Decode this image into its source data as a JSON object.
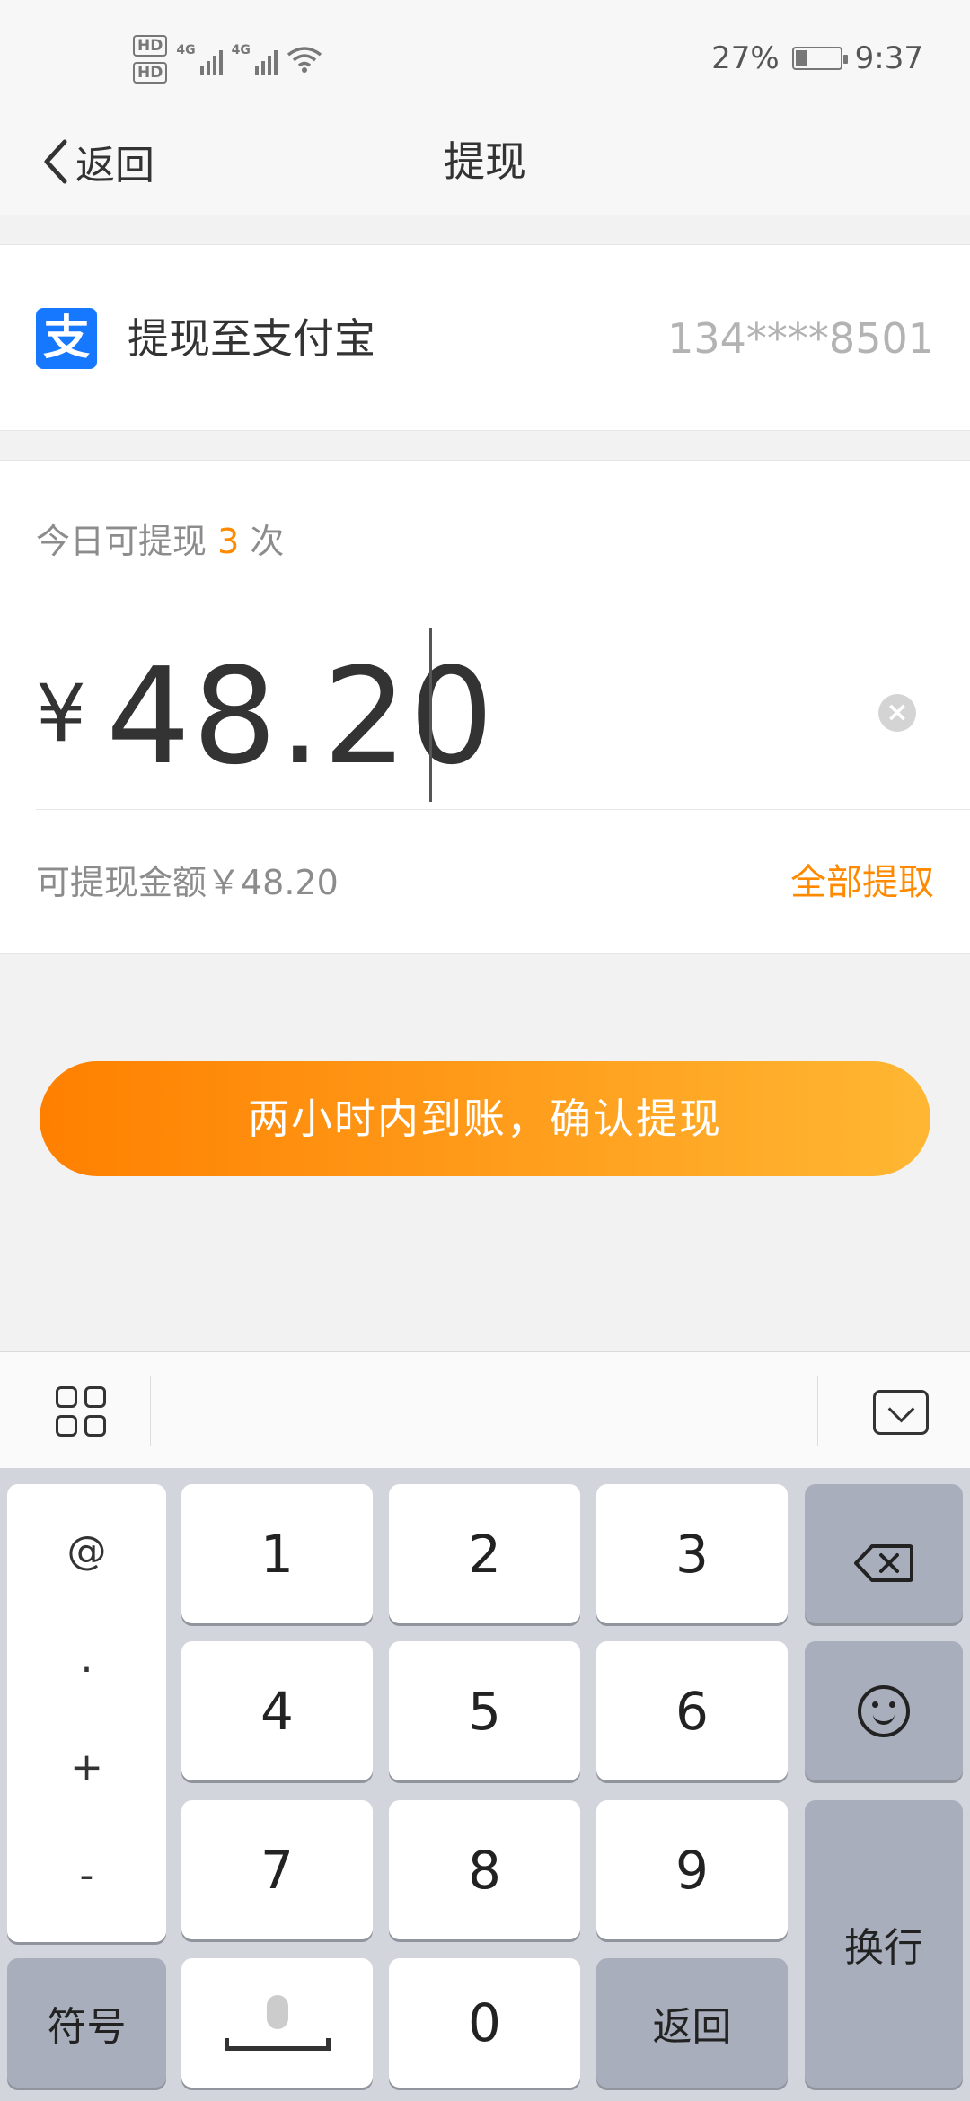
{
  "status_bar": {
    "hd1": "HD",
    "hd2": "HD",
    "net1": "4G",
    "net2": "4G",
    "battery_pct": "27%",
    "time": "9:37",
    "icons": [
      "signal-icon",
      "wifi-icon",
      "battery-icon"
    ]
  },
  "nav": {
    "back_label": "返回",
    "title": "提现"
  },
  "alipay": {
    "logo_char": "支",
    "label": "提现至支付宝",
    "account": "134****8501"
  },
  "amount": {
    "daily_prefix": "今日可提现 ",
    "daily_count": "3",
    "daily_suffix": " 次",
    "currency": "¥",
    "value": "48.20",
    "available_text": "可提现金额￥48.20",
    "withdraw_all": "全部提取"
  },
  "confirm_button": "两小时内到账，确认提现",
  "keyboard": {
    "sym_col": [
      "@",
      ".",
      "+",
      "-"
    ],
    "digits": [
      "1",
      "2",
      "3",
      "4",
      "5",
      "6",
      "7",
      "8",
      "9",
      "0"
    ],
    "symbols_key": "符号",
    "return_key": "返回",
    "enter_key": "换行"
  },
  "colors": {
    "accent": "#ff8a00",
    "alipay_blue": "#1677ff",
    "button_gradient_start": "#ff8000",
    "button_gradient_end": "#ffb733"
  }
}
